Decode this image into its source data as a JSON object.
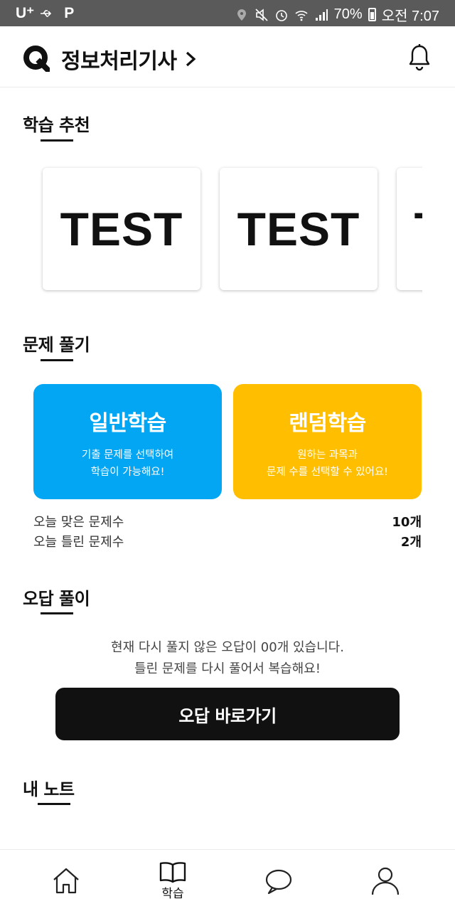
{
  "status_bar": {
    "carrier": "U⁺",
    "app_badge": "P",
    "battery": "70%",
    "time": "오전 7:07"
  },
  "header": {
    "title": "정보처리기사",
    "icons": [
      "logo-q-icon",
      "chevron-right-icon",
      "bell-icon"
    ]
  },
  "recommend": {
    "title": "학습 추천",
    "cards": [
      {
        "label": "TEST"
      },
      {
        "label": "TEST"
      },
      {
        "label": "TEST"
      }
    ]
  },
  "solve": {
    "title": "문제 풀기",
    "general": {
      "title": "일반학습",
      "desc_line1": "기출 문제를 선택하여",
      "desc_line2": "학습이 가능해요!",
      "color": "#03a6f2"
    },
    "random": {
      "title": "랜덤학습",
      "desc_line1": "원하는 과목과",
      "desc_line2": "문제 수를 선택할 수 있어요!",
      "color": "#ffbf00"
    },
    "stats": [
      {
        "label": "오늘 맞은 문제수",
        "value": "10개"
      },
      {
        "label": "오늘 틀린 문제수",
        "value": "2개"
      }
    ]
  },
  "wrong": {
    "title": "오답 풀이",
    "line1": "현재 다시 풀지 않은 오답이 00개 있습니다.",
    "line2": "틀린 문제를 다시 풀어서 복습해요!",
    "button_label": "오답 바로가기"
  },
  "notes": {
    "title": "내 노트"
  },
  "bottom_nav": {
    "items": [
      {
        "icon": "home-icon",
        "label": ""
      },
      {
        "icon": "book-icon",
        "label": "학습"
      },
      {
        "icon": "chat-bubble-icon",
        "label": ""
      },
      {
        "icon": "user-icon",
        "label": ""
      }
    ]
  }
}
